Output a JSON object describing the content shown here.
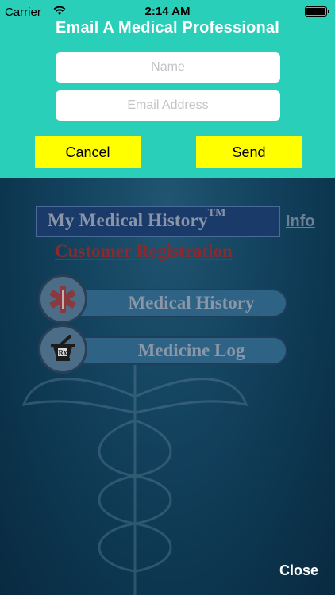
{
  "status_bar": {
    "carrier": "Carrier",
    "time": "2:14 AM",
    "battery_level": 1.0
  },
  "modal": {
    "title": "Email A Medical Professional",
    "name_field": {
      "placeholder": "Name",
      "value": ""
    },
    "email_field": {
      "placeholder": "Email Address",
      "value": ""
    },
    "cancel_label": "Cancel",
    "send_label": "Send",
    "accent_color": "#2acfb9",
    "button_color": "#ffff00"
  },
  "background_app": {
    "logo_text": "My Medical History",
    "logo_trademark": "TM",
    "info_label": "Info",
    "registration_label": "Customer Registration",
    "menu": [
      {
        "label": "Medical History",
        "icon": "star-of-life-icon"
      },
      {
        "label": "Medicine Log",
        "icon": "mortar-pestle-rx-icon"
      }
    ]
  },
  "close_label": "Close"
}
